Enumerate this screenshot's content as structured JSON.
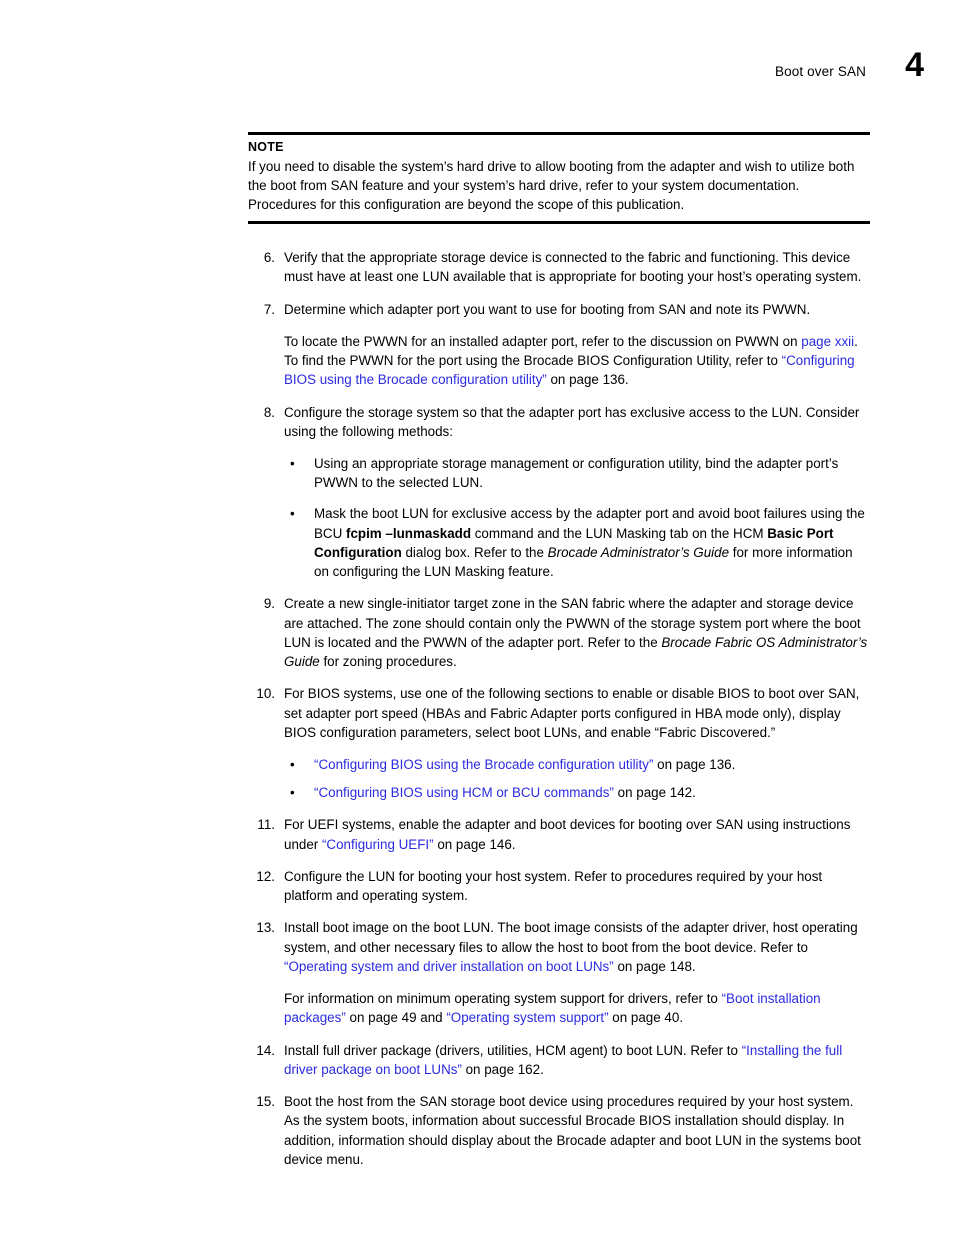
{
  "header": {
    "title": "Boot over SAN",
    "chapter_number": "4"
  },
  "colors": {
    "link": "#2b2be0",
    "text": "#000000",
    "rule": "#000000"
  },
  "note": {
    "label": "NOTE",
    "body": "If you need to disable the system’s hard drive to allow booting from the adapter and wish to utilize both the boot from SAN feature and your system’s hard drive, refer to your system documentation. Procedures for this configuration are beyond the scope of this publication."
  },
  "steps": [
    {
      "number": "6.",
      "paragraphs": [
        "Verify that the appropriate storage device is connected to the fabric and functioning. This device must have at least one LUN available that is appropriate for booting your host’s operating system."
      ]
    },
    {
      "number": "7.",
      "paragraphs": [
        "Determine which adapter port you want to use for booting from SAN and note its PWWN."
      ],
      "paragraph2_parts": {
        "lead": "To locate the PWWN for an installed adapter port, refer to the discussion on PWWN on ",
        "link1": "page xxii",
        "mid": ". To find the PWWN for the port using the Brocade BIOS Configuration Utility, refer to ",
        "link2": "“Configuring BIOS using the Brocade configuration utility”",
        "tail": " on page 136."
      }
    },
    {
      "number": "8.",
      "paragraphs": [
        "Configure the storage system so that the adapter port has exclusive access to the LUN. Consider using the following methods:"
      ]
    },
    {
      "number": "9.",
      "paragraphs": []
    },
    {
      "number": "10.",
      "paragraphs": []
    },
    {
      "number": "11.",
      "paragraphs": []
    },
    {
      "number": "12.",
      "paragraphs": [
        "Configure the LUN for booting your host system. Refer to procedures required by your host platform and operating system."
      ]
    },
    {
      "number": "13.",
      "paragraphs": []
    },
    {
      "number": "14.",
      "paragraphs": []
    },
    {
      "number": "15.",
      "paragraphs": [
        "Boot the host from the SAN storage boot device using procedures required by your host system. As the system boots, information about successful Brocade BIOS installation should display. In addition, information should display about the Brocade adapter and boot LUN in the systems boot device menu."
      ]
    }
  ],
  "step8_bullets": {
    "bullet_glyph": "•",
    "b1": "Using an appropriate storage management or configuration utility, bind the adapter port’s PWWN to the selected LUN.",
    "b2_parts": {
      "p1": "Mask the boot LUN for exclusive access by the adapter port and avoid boot failures using the BCU ",
      "bold1": "fcpim –lunmaskadd",
      "p2": " command and the LUN Masking tab on the HCM ",
      "bold2": "Basic Port Configuration",
      "p3": " dialog box. Refer to the ",
      "italic1": "Brocade Administrator’s Guide",
      "p4": " for more information on configuring the LUN Masking feature."
    }
  },
  "step9": {
    "p1": "Create a new single-initiator target zone in the SAN fabric where the adapter and storage device are attached. The zone should contain only the PWWN of the storage system port where the boot LUN is located and the PWWN of the adapter port. Refer to the ",
    "italic1": "Brocade Fabric OS Administrator’s Guide",
    "p2": " for zoning procedures."
  },
  "step10": {
    "p1": "For BIOS systems, use one of the following sections to enable or disable BIOS to boot over SAN, set adapter port speed (HBAs and Fabric Adapter ports configured in HBA mode only), display BIOS configuration parameters, select boot LUNs, and enable “Fabric Discovered.”",
    "bullets": [
      {
        "link": "“Configuring BIOS using the Brocade configuration utility”",
        "tail": " on page 136."
      },
      {
        "link": "“Configuring BIOS using HCM or BCU commands”",
        "tail": " on page 142."
      }
    ]
  },
  "step11": {
    "p1": "For UEFI systems, enable the adapter and boot devices for booting over SAN using instructions under ",
    "link1": "“Configuring UEFI”",
    "p2": " on page 146."
  },
  "step13": {
    "p1": "Install boot image on the boot LUN. The boot image consists of the adapter driver, host operating system, and other necessary files to allow the host to boot from the boot device. Refer to ",
    "link1": "“Operating system and driver installation on boot LUNs”",
    "p2": " on page 148.",
    "p3": "For information on minimum operating system support for drivers, refer to ",
    "link2": "“Boot installation packages”",
    "p4": " on page 49 and ",
    "link3": "“Operating system support”",
    "p5": " on page 40."
  },
  "step14": {
    "p1": "Install full driver package (drivers, utilities, HCM agent) to boot LUN. Refer to ",
    "link1": "“Installing the full driver package on boot LUNs”",
    "p2": " on page 162."
  }
}
